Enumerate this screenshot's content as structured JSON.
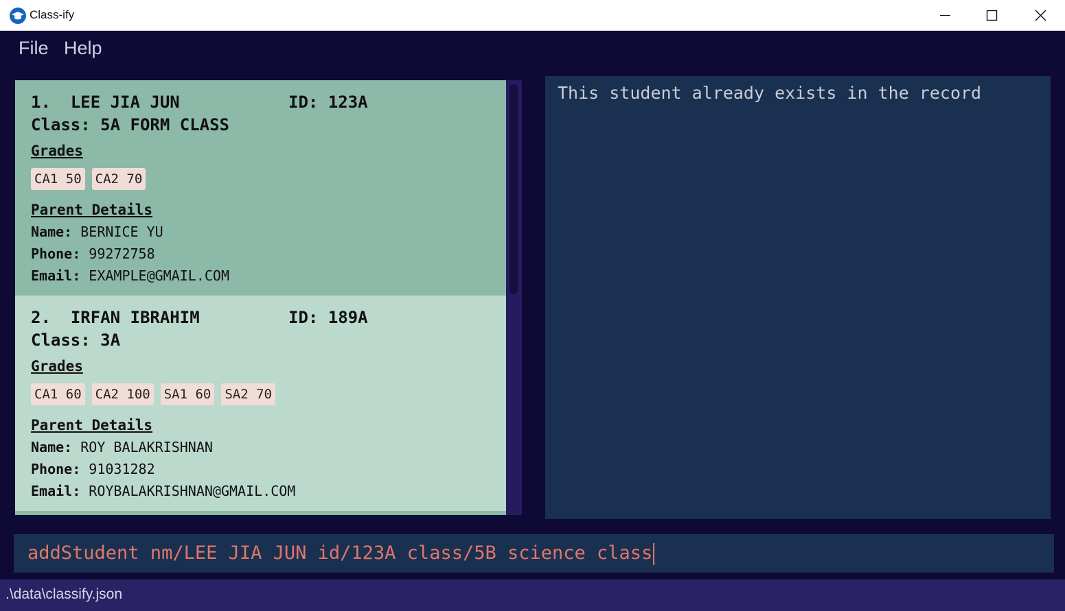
{
  "window": {
    "title": "Class-ify"
  },
  "menu": {
    "file": "File",
    "help": "Help"
  },
  "students": [
    {
      "index": "1.",
      "name": "LEE JIA JUN",
      "id_label": "ID:",
      "id": "123A",
      "class_label": "Class:",
      "class": "5A FORM CLASS",
      "grades_heading": "Grades",
      "grades": [
        "CA1 50",
        "CA2 70"
      ],
      "parent_heading": "Parent Details",
      "parent_name_label": "Name:",
      "parent_name": "BERNICE YU",
      "phone_label": "Phone:",
      "phone": "99272758",
      "email_label": "Email:",
      "email": "EXAMPLE@GMAIL.COM"
    },
    {
      "index": "2.",
      "name": "IRFAN IBRAHIM",
      "id_label": "ID:",
      "id": "189A",
      "class_label": "Class:",
      "class": "3A",
      "grades_heading": "Grades",
      "grades": [
        "CA1 60",
        "CA2 100",
        "SA1 60",
        "SA2 70"
      ],
      "parent_heading": "Parent Details",
      "parent_name_label": "Name:",
      "parent_name": "ROY BALAKRISHNAN",
      "phone_label": "Phone:",
      "phone": "91031282",
      "email_label": "Email:",
      "email": "ROYBALAKRISHNAN@GMAIL.COM"
    }
  ],
  "result": {
    "message": "This student already exists in the record"
  },
  "command": {
    "value": "addStudent nm/LEE JIA JUN id/123A class/5B science class"
  },
  "status": {
    "path": ".\\data\\classify.json"
  },
  "colors": {
    "background": "#0f0935",
    "selected_card": "#8db9a9",
    "card": "#bcd9cd",
    "panel": "#1a3050",
    "command_text": "#e0766a",
    "tag": "#f2dcd8"
  },
  "icons": {
    "app": "graduation-cap-icon",
    "minimize": "minimize-icon",
    "maximize": "maximize-icon",
    "close": "close-icon"
  }
}
